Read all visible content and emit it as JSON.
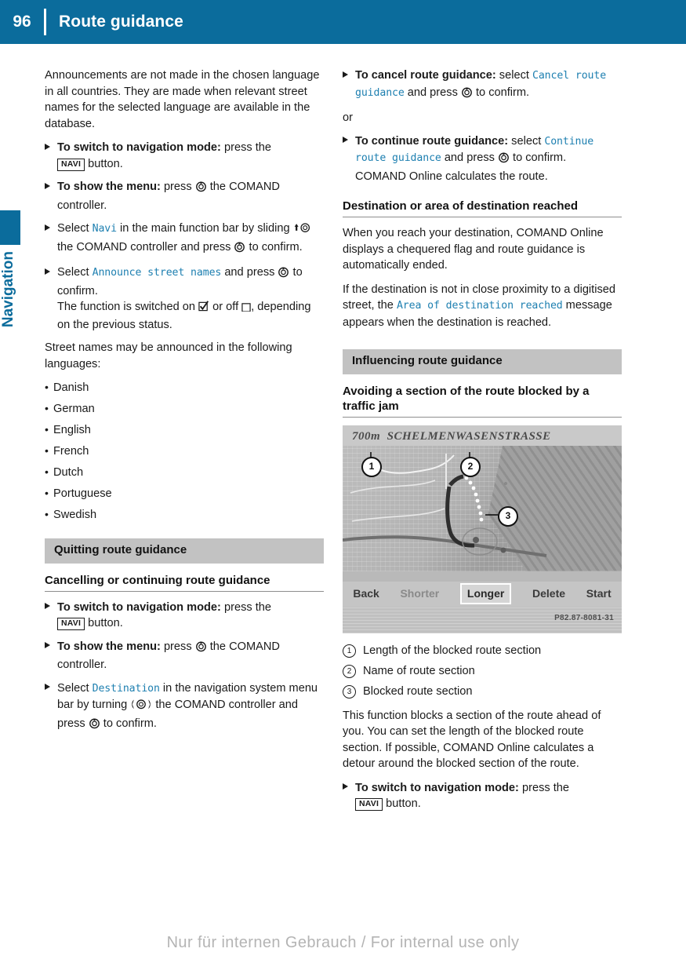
{
  "theme": {
    "brand": "#0b6c9c",
    "screen_text": "#1d7fb0",
    "section_bar": "#c2c2c2"
  },
  "header": {
    "page_number": "96",
    "title": "Route guidance"
  },
  "sidebar": {
    "chapter_label": "Navigation"
  },
  "left_column": {
    "intro": "Announcements are not made in the chosen language in all countries. They are made when relevant street names for the selected language are available in the database.",
    "steps": [
      {
        "bold": "To switch to navigation mode:",
        "after": " press the ",
        "key": "NAVI",
        "tail": " button."
      },
      {
        "bold": "To show the menu:",
        "after": " press ",
        "icon": "press-controller-icon",
        "tail": " the COMAND controller."
      },
      {
        "lead": "Select ",
        "screen": "Navi",
        "mid": " in the main function bar by sliding ",
        "icon2": "slide-controller-icon",
        "mid2": " the COMAND controller and press ",
        "icon3": "press-controller-icon",
        "tail": " to confirm."
      },
      {
        "lead": "Select ",
        "screen": "Announce street names",
        "mid": " and press ",
        "icon": "press-controller-icon",
        "tail": " to confirm.",
        "note_a": "The function is switched on ",
        "note_on_icon": "checkbox-checked-icon",
        "note_b": " or off ",
        "note_off_icon": "checkbox-empty-icon",
        "note_c": ", depending on the previous status."
      }
    ],
    "languages_intro": "Street names may be announced in the following languages:",
    "languages": [
      "Danish",
      "German",
      "English",
      "French",
      "Dutch",
      "Portuguese",
      "Swedish"
    ],
    "section_bar": "Quitting route guidance",
    "sub_heading": "Cancelling or continuing route guidance",
    "steps2": [
      {
        "bold": "To switch to navigation mode:",
        "after": " press the ",
        "key": "NAVI",
        "tail": " button."
      },
      {
        "bold": "To show the menu:",
        "after": " press ",
        "icon": "press-controller-icon",
        "tail": " the COMAND controller."
      },
      {
        "lead": "Select ",
        "screen": "Destination",
        "mid": " in the navigation system menu bar by turning ",
        "icon2": "turn-controller-icon",
        "mid2": " the COMAND controller and press ",
        "icon3": "press-controller-icon",
        "tail": " to confirm."
      }
    ]
  },
  "right_column": {
    "steps": [
      {
        "bold": "To cancel route guidance:",
        "after": " select ",
        "screen": "Cancel route guidance",
        "mid": " and press ",
        "icon": "press-controller-icon",
        "tail": " to confirm."
      }
    ],
    "or_label": "or",
    "steps_b": [
      {
        "bold": "To continue route guidance:",
        "after": " select ",
        "screen": "Continue route guidance",
        "mid": " and press ",
        "icon": "press-controller-icon",
        "tail": " to confirm.",
        "note": "COMAND Online calculates the route."
      }
    ],
    "sub_heading": "Destination or area of destination reached",
    "para1": "When you reach your destination, COMAND Online displays a chequered flag and route guidance is automatically ended.",
    "para2_a": "If the destination is not in close proximity to a digitised street, the ",
    "para2_screen": "Area of destination reached",
    "para2_b": " message appears when the destination is reached.",
    "section_bar": "Influencing route guidance",
    "sub_heading2": "Avoiding a section of the route blocked by a traffic jam",
    "figure": {
      "distance": "700m",
      "street": "SCHELMENWASENSTRASSE",
      "buttons": [
        "Back",
        "Shorter",
        "Longer",
        "Delete",
        "Start"
      ],
      "selected_button": "Longer",
      "dimmed_button": "Shorter",
      "callouts": [
        "1",
        "2",
        "3"
      ],
      "reference_code": "P82.87-8081-31"
    },
    "legend": [
      {
        "num": "1",
        "text": "Length of the blocked route section"
      },
      {
        "num": "2",
        "text": "Name of route section"
      },
      {
        "num": "3",
        "text": "Blocked route section"
      }
    ],
    "para3": "This function blocks a section of the route ahead of you. You can set the length of the blocked route section. If possible, COMAND Online calculates a detour around the blocked section of the route.",
    "steps_c": [
      {
        "bold": "To switch to navigation mode:",
        "after": " press the ",
        "key": "NAVI",
        "tail": " button."
      }
    ]
  },
  "footer": {
    "watermark": "Nur für internen Gebrauch / For internal use only"
  }
}
